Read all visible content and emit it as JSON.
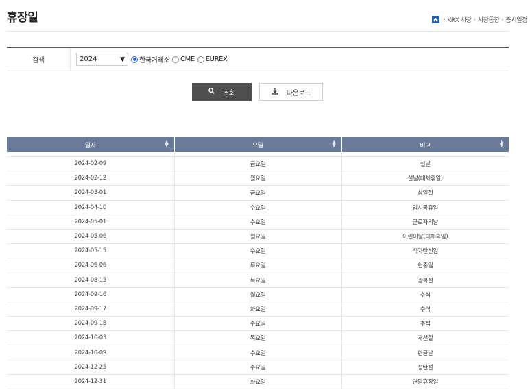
{
  "page": {
    "title": "휴장일",
    "breadcrumb": [
      "KRX 시장",
      "시장동향",
      "증시일정"
    ]
  },
  "search": {
    "label": "검색",
    "year_value": "2024",
    "markets": [
      {
        "label": "한국거래소",
        "selected": true
      },
      {
        "label": "CME",
        "selected": false
      },
      {
        "label": "EUREX",
        "selected": false
      }
    ]
  },
  "buttons": {
    "search_label": "조회",
    "download_label": "다운로드"
  },
  "table": {
    "columns": [
      "일자",
      "요일",
      "비고"
    ],
    "rows": [
      [
        "2024-02-09",
        "금요일",
        "설날"
      ],
      [
        "2024-02-12",
        "월요일",
        "설날(대체휴일)"
      ],
      [
        "2024-03-01",
        "금요일",
        "삼일절"
      ],
      [
        "2024-04-10",
        "수요일",
        "임시공휴일"
      ],
      [
        "2024-05-01",
        "수요일",
        "근로자의날"
      ],
      [
        "2024-05-06",
        "월요일",
        "어린이날(대체휴일)"
      ],
      [
        "2024-05-15",
        "수요일",
        "석가탄신일"
      ],
      [
        "2024-06-06",
        "목요일",
        "현충일"
      ],
      [
        "2024-08-15",
        "목요일",
        "광복절"
      ],
      [
        "2024-09-16",
        "월요일",
        "추석"
      ],
      [
        "2024-09-17",
        "화요일",
        "추석"
      ],
      [
        "2024-09-18",
        "수요일",
        "추석"
      ],
      [
        "2024-10-03",
        "목요일",
        "개천절"
      ],
      [
        "2024-10-09",
        "수요일",
        "한글날"
      ],
      [
        "2024-12-25",
        "수요일",
        "성탄절"
      ],
      [
        "2024-12-31",
        "화요일",
        "연말휴장일"
      ]
    ]
  },
  "colors": {
    "header_bg": "#6a7a99",
    "search_button_bg": "#4f4f4f",
    "accent": "#1f5fa8"
  },
  "icons": {
    "home": "home-icon",
    "search": "search-icon",
    "download": "download-icon",
    "sort": "sort-icon",
    "dropdown": "chevron-down-icon"
  }
}
